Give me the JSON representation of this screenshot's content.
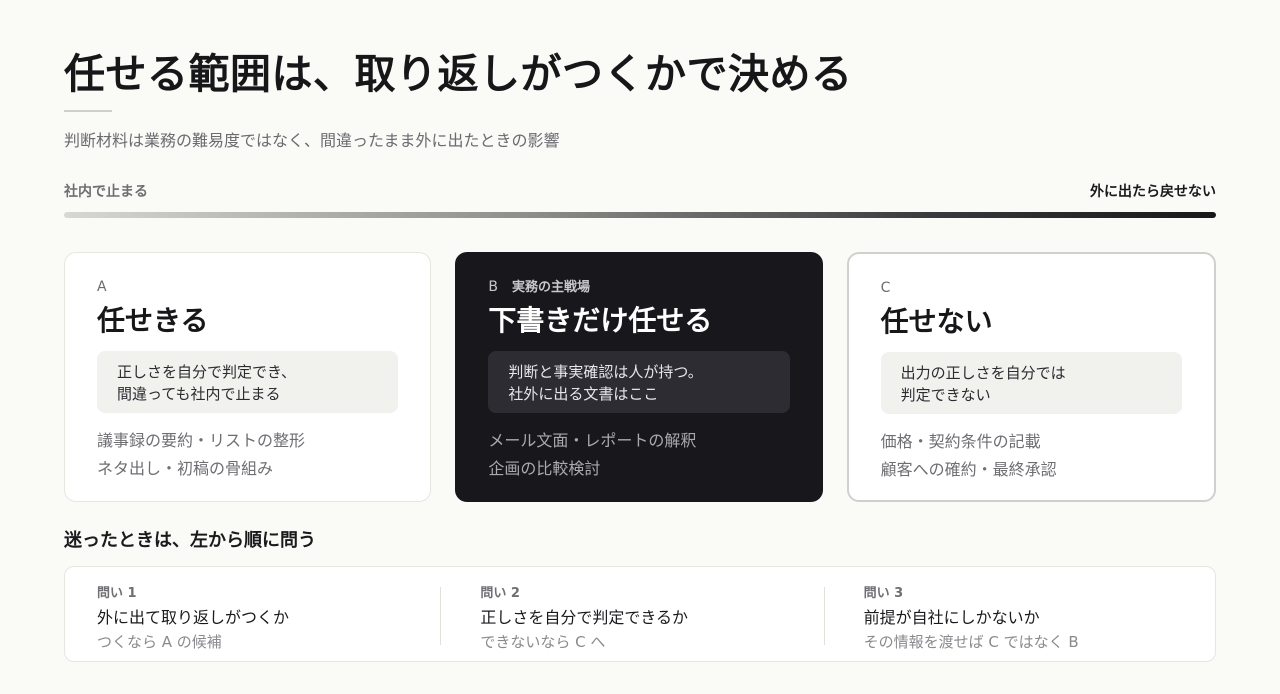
{
  "header": {
    "title": "任せる範囲は、取り返しがつくかで決める",
    "subtitle": "判断材料は業務の難易度ではなく、間違ったまま外に出たときの影響"
  },
  "scale": {
    "left_label": "社内で止まる",
    "right_label": "外に出たら戻せない"
  },
  "cards": [
    {
      "tag": "A",
      "tag_note": "",
      "heading": "任せきる",
      "note_lines": [
        "正しさを自分で判定でき、",
        "間違っても社内で止まる"
      ],
      "examples": [
        "議事録の要約・リストの整形",
        "ネタ出し・初稿の骨組み"
      ]
    },
    {
      "tag": "B",
      "tag_note": "実務の主戦場",
      "heading": "下書きだけ任せる",
      "note_lines": [
        "判断と事実確認は人が持つ。",
        "社外に出る文書はここ"
      ],
      "examples": [
        "メール文面・レポートの解釈",
        "企画の比較検討"
      ]
    },
    {
      "tag": "C",
      "tag_note": "",
      "heading": "任せない",
      "note_lines": [
        "出力の正しさを自分では",
        "判定できない"
      ],
      "examples": [
        "価格・契約条件の記載",
        "顧客への確約・最終承認"
      ]
    }
  ],
  "questions": {
    "title": "迷ったときは、左から順に問う",
    "items": [
      {
        "label": "問い 1",
        "text": "外に出て取り返しがつくか",
        "hint": "つくなら A の候補"
      },
      {
        "label": "問い 2",
        "text": "正しさを自分で判定できるか",
        "hint": "できないなら C へ"
      },
      {
        "label": "問い 3",
        "text": "前提が自社にしかないか",
        "hint": "その情報を渡せば C ではなく B"
      }
    ]
  },
  "colors": {
    "background": "#fafaf7",
    "dark_card": "#18181c",
    "muted_text": "#6e6e73"
  }
}
